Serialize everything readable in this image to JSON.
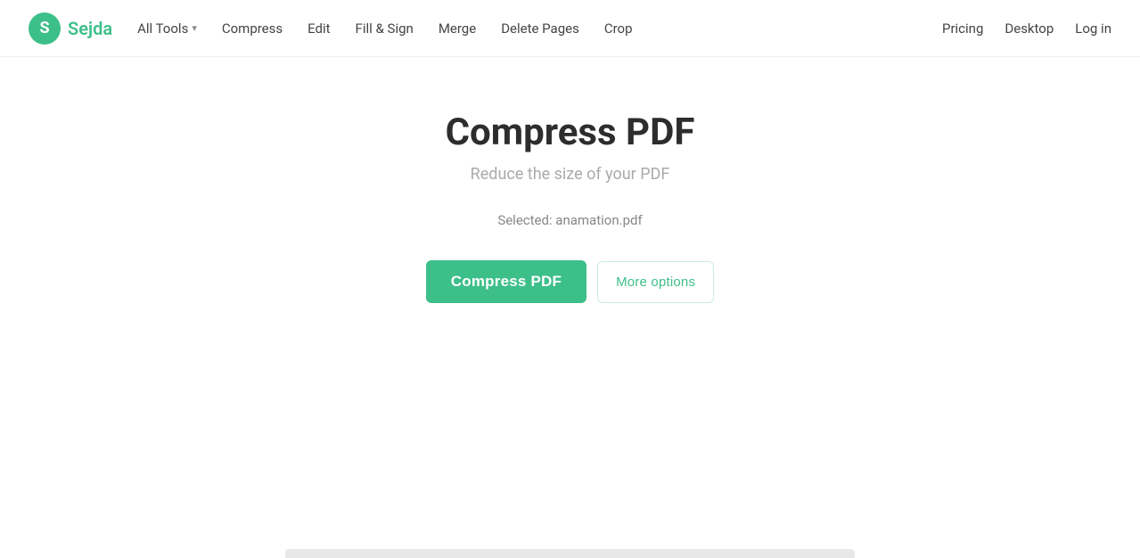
{
  "logo": {
    "icon_letter": "S",
    "text": "Sejda"
  },
  "nav": {
    "left": [
      {
        "label": "All Tools",
        "has_dropdown": true
      },
      {
        "label": "Compress",
        "has_dropdown": false
      },
      {
        "label": "Edit",
        "has_dropdown": false
      },
      {
        "label": "Fill & Sign",
        "has_dropdown": false
      },
      {
        "label": "Merge",
        "has_dropdown": false
      },
      {
        "label": "Delete Pages",
        "has_dropdown": false
      },
      {
        "label": "Crop",
        "has_dropdown": false
      }
    ],
    "right": [
      {
        "label": "Pricing"
      },
      {
        "label": "Desktop"
      },
      {
        "label": "Log in"
      }
    ]
  },
  "main": {
    "title": "Compress PDF",
    "subtitle": "Reduce the size of your PDF",
    "selected_file_label": "Selected: anamation.pdf",
    "compress_button_label": "Compress PDF",
    "more_options_label": "More options"
  }
}
